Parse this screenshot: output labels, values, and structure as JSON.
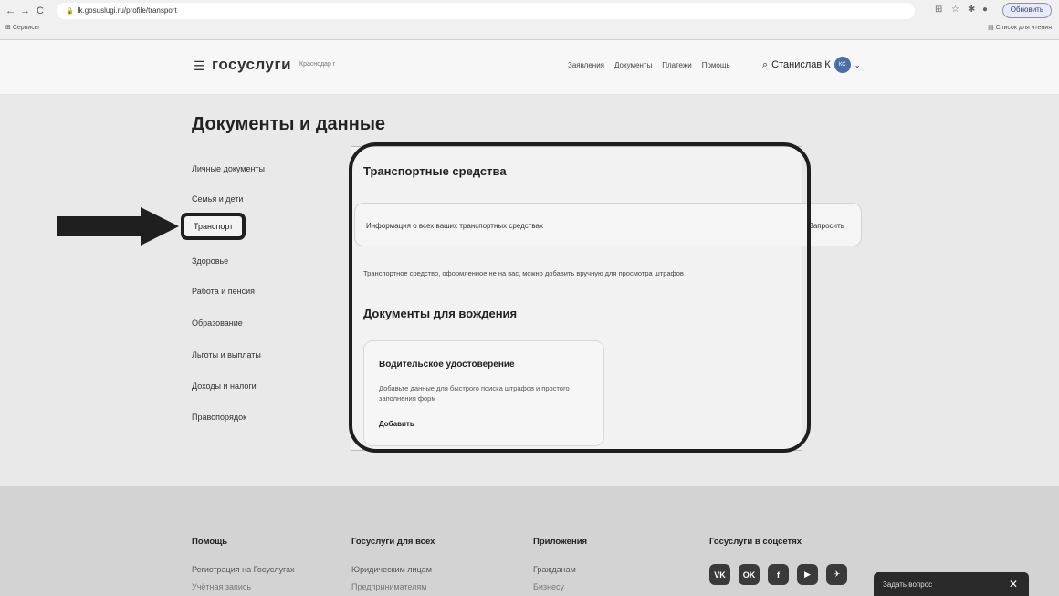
{
  "browser": {
    "back": "←",
    "forward": "→",
    "reload": "C",
    "url": "lk.gosuslugi.ru/profile/transport",
    "update_label": "Обновить",
    "bookmarks_label": "Сервисы",
    "reading_list_label": "Список для чтения"
  },
  "header": {
    "logo": "госуслуги",
    "region": "Краснодар г",
    "nav": [
      "Заявления",
      "Документы",
      "Платежи",
      "Помощь"
    ],
    "user_name": "Станислав К",
    "avatar_initials": "КС"
  },
  "page": {
    "title": "Документы и данные"
  },
  "sidebar": {
    "items": [
      {
        "label": "Личные документы"
      },
      {
        "label": "Семья и дети"
      },
      {
        "label": "Транспорт"
      },
      {
        "label": "Здоровье"
      },
      {
        "label": "Работа и пенсия"
      },
      {
        "label": "Образование"
      },
      {
        "label": "Льготы и выплаты"
      },
      {
        "label": "Доходы и налоги"
      },
      {
        "label": "Правопорядок"
      }
    ]
  },
  "transport": {
    "title": "Транспортные средства",
    "info_text": "Информация о всех ваших транспортных средствах",
    "request_label": "Запросить",
    "note": "Транспортное средство, оформленное не на вас, можно добавить вручную для просмотра штрафов"
  },
  "driving": {
    "title": "Документы для вождения",
    "card_title": "Водительское удостоверение",
    "card_desc": "Добавьте данные для быстрого поиска штрафов и простого заполнения форм",
    "add_label": "Добавить"
  },
  "footer": {
    "columns": [
      {
        "head": "Помощь",
        "link": "Регистрация на Госуслугах",
        "link2": "Учётная запись"
      },
      {
        "head": "Госуслуги для всех",
        "link": "Юридическим лицам",
        "link2": "Предпринимателям"
      },
      {
        "head": "Приложения",
        "link": "Гражданам",
        "link2": "Бизнесу"
      },
      {
        "head": "Госуслуги в соцсетях"
      }
    ],
    "social": [
      "VK",
      "OK",
      "f",
      "▶",
      "✈"
    ]
  },
  "chat": {
    "label": "Задать вопрос",
    "close": "✕"
  }
}
